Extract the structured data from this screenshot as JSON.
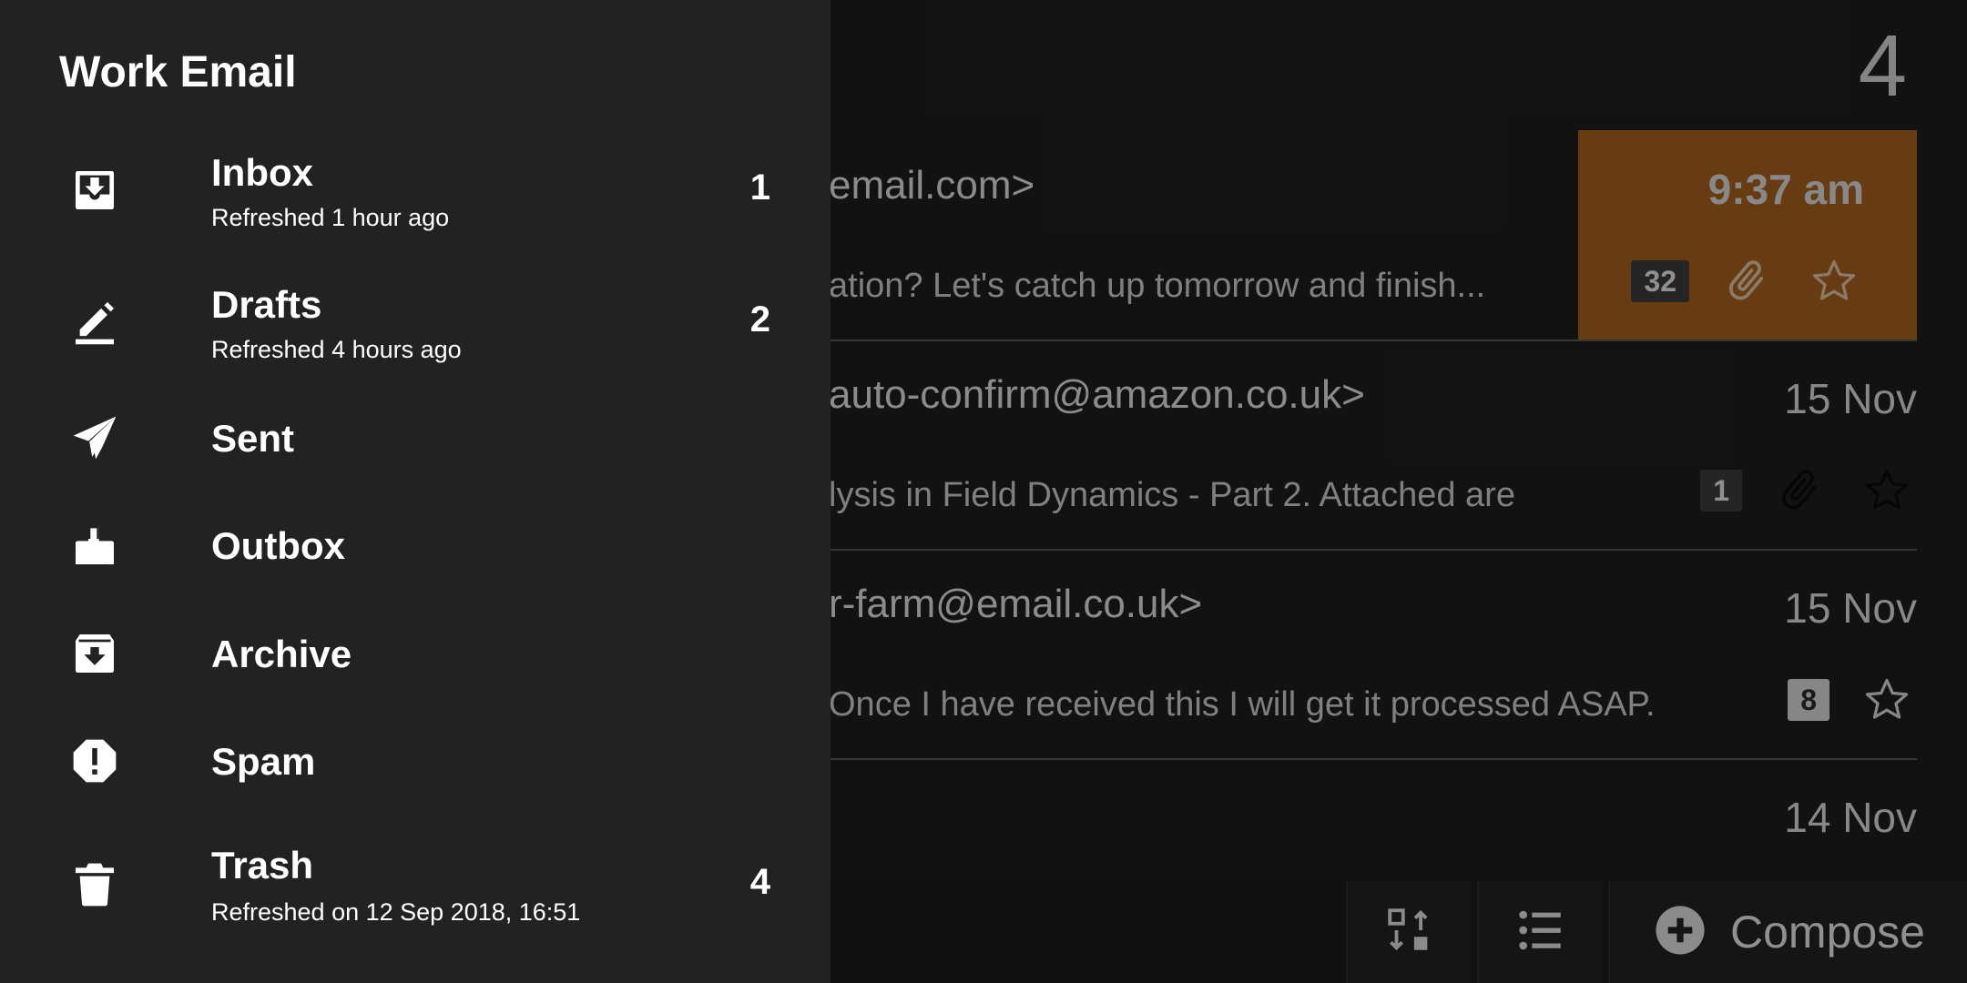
{
  "mail_list": {
    "folder_count": "4",
    "messages": [
      {
        "sender": "email.com>",
        "preview": "ation? Let's catch up tomorrow and finish...",
        "date": "9:37 am",
        "badge": "32",
        "attachment": true,
        "starred": false
      },
      {
        "sender": "auto-confirm@amazon.co.uk>",
        "preview": "lysis in Field Dynamics - Part 2. Attached are",
        "date": "15 Nov",
        "badge": "1",
        "attachment": true,
        "starred": false
      },
      {
        "sender": "r-farm@email.co.uk>",
        "preview": "Once I have received this I will get it processed ASAP.",
        "date": "15 Nov",
        "badge": "8",
        "attachment": false,
        "starred": false
      },
      {
        "sender": "",
        "preview": "",
        "date": "14 Nov"
      }
    ]
  },
  "bottom_bar": {
    "compose_label": "Compose"
  },
  "drawer": {
    "account_title": "Work Email",
    "folders": [
      {
        "name": "Inbox",
        "subtitle": "Refreshed 1 hour ago",
        "count": "1",
        "icon": "inbox-icon"
      },
      {
        "name": "Drafts",
        "subtitle": "Refreshed 4 hours ago",
        "count": "2",
        "icon": "pencil-icon"
      },
      {
        "name": "Sent",
        "subtitle": "",
        "count": "",
        "icon": "paper-plane-icon"
      },
      {
        "name": "Outbox",
        "subtitle": "",
        "count": "",
        "icon": "outbox-icon"
      },
      {
        "name": "Archive",
        "subtitle": "",
        "count": "",
        "icon": "archive-icon"
      },
      {
        "name": "Spam",
        "subtitle": "",
        "count": "",
        "icon": "spam-icon"
      },
      {
        "name": "Trash",
        "subtitle": "Refreshed on 12 Sep 2018, 16:51",
        "count": "4",
        "icon": "trash-icon"
      }
    ]
  },
  "colors": {
    "highlight": "#a8621f",
    "drawer_bg": "#222222",
    "list_bg": "#1e1e1e"
  }
}
